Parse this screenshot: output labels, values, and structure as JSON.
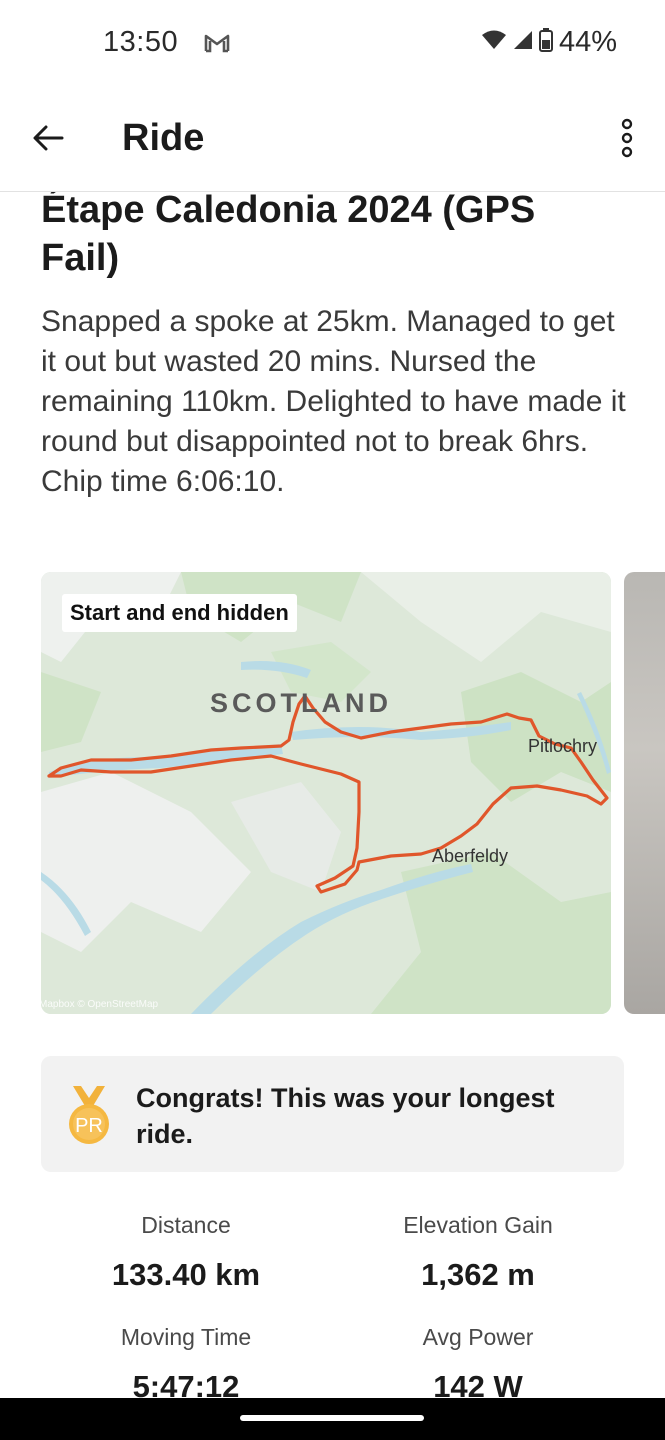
{
  "status_bar": {
    "time": "13:50",
    "battery": "44%",
    "icons": [
      "gmail-icon",
      "wifi-icon",
      "signal-icon",
      "battery-icon"
    ]
  },
  "app_bar": {
    "title": "Ride",
    "back_icon": "arrow-left-icon",
    "more_icon": "more-vertical-icon"
  },
  "activity": {
    "title": "Étape Caledonia 2024 (GPS Fail)",
    "description": "Snapped a spoke at 25km. Managed to get it out but wasted 20 mins. Nursed the remaining 110km. Delighted to have made it round but disappointed not to break 6hrs. Chip time 6:06:10."
  },
  "map": {
    "badge": "Start and end hidden",
    "region_label": "SCOTLAND",
    "towns": [
      "Pitlochry",
      "Aberfeldy"
    ],
    "attribution": "Mapbox © OpenStreetMap",
    "route_color": "#e0562b"
  },
  "achievement": {
    "icon": "pr-medal-icon",
    "medal_text": "PR",
    "text": "Congrats! This was your longest ride."
  },
  "stats": [
    {
      "label": "Distance",
      "value": "133.40 km"
    },
    {
      "label": "Elevation Gain",
      "value": "1,362 m"
    },
    {
      "label": "Moving Time",
      "value": "5:47:12"
    },
    {
      "label": "Avg Power",
      "value": "142 W"
    }
  ]
}
